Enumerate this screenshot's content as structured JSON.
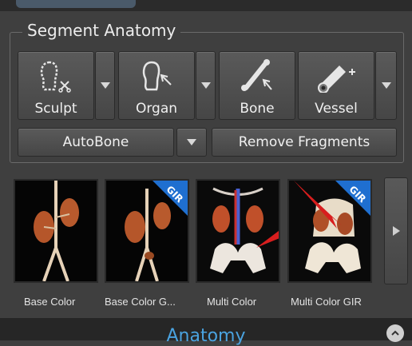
{
  "group": {
    "title": "Segment Anatomy"
  },
  "tools": [
    {
      "label": "Sculpt",
      "icon": "sculpt-icon"
    },
    {
      "label": "Organ",
      "icon": "organ-icon"
    },
    {
      "label": "Bone",
      "icon": "bone-icon"
    },
    {
      "label": "Vessel",
      "icon": "vessel-icon"
    }
  ],
  "autobone": {
    "label": "AutoBone"
  },
  "remove_fragments": {
    "label": "Remove Fragments"
  },
  "presets": [
    {
      "label": "Base Color",
      "badge": ""
    },
    {
      "label": "Base Color G...",
      "badge": "GIR"
    },
    {
      "label": "Multi Color",
      "badge": ""
    },
    {
      "label": "Multi Color GIR",
      "badge": "GIR"
    }
  ],
  "footer": {
    "title": "Anatomy"
  },
  "colors": {
    "accent": "#4aa3e0",
    "badge": "#1f6fd0",
    "arrow": "#d81e1e"
  }
}
